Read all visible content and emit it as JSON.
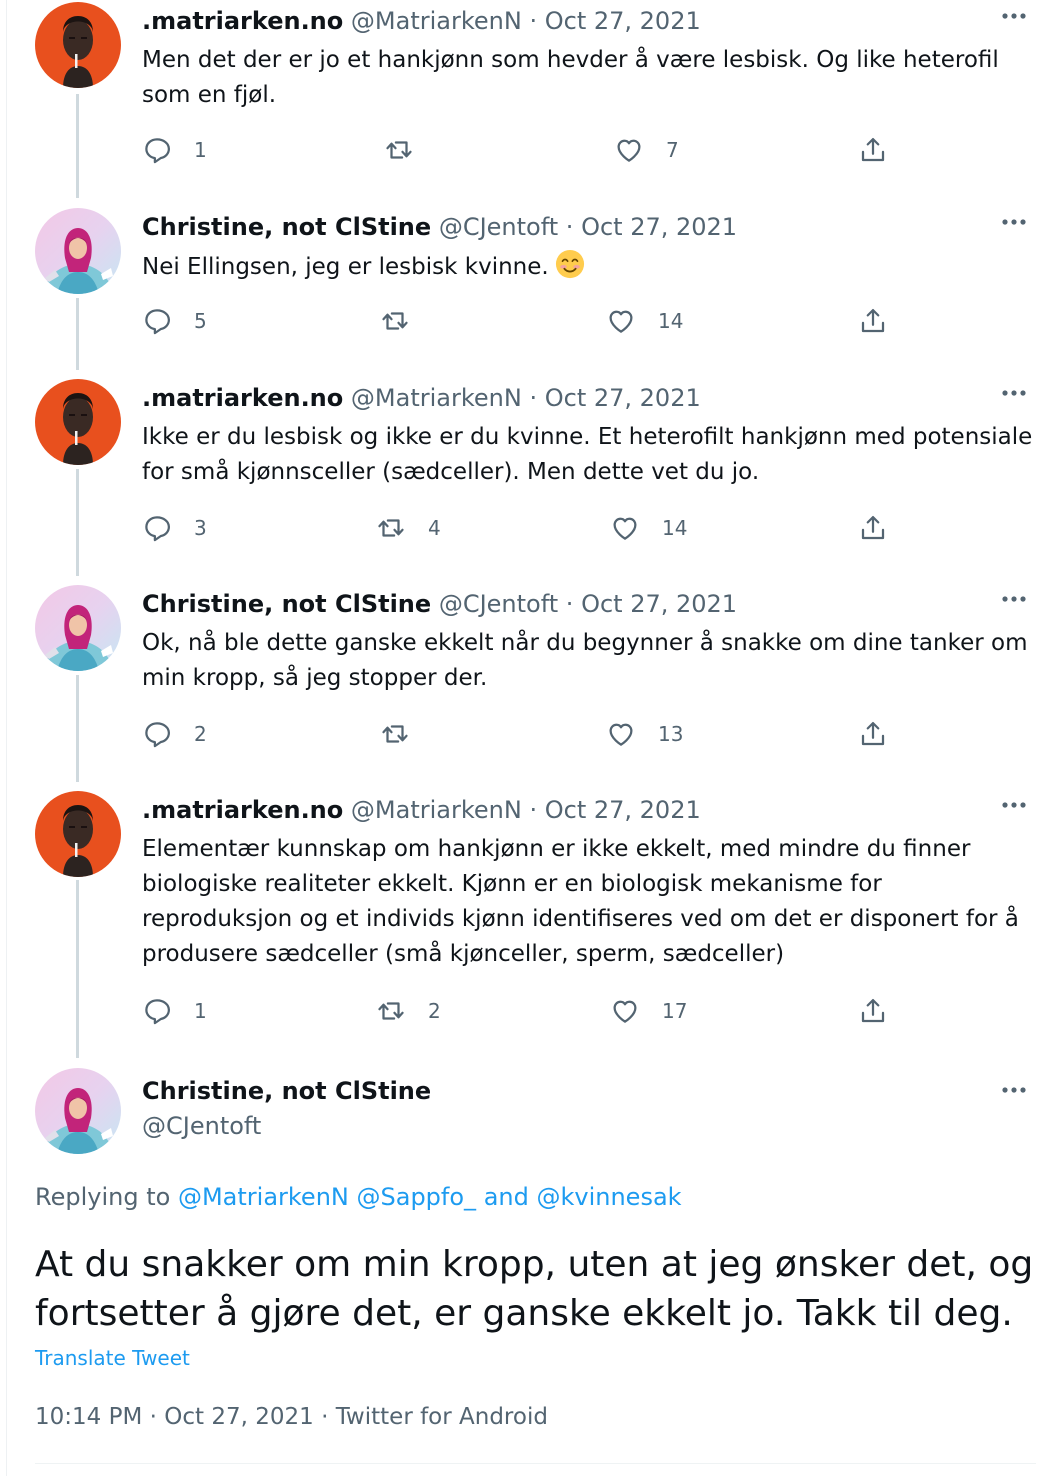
{
  "tweets": [
    {
      "name": ".matriarken.no",
      "handle": "@MatriarkenN",
      "sep": "·",
      "date": "Oct 27, 2021",
      "text": "Men det der er jo et hankjønn som hevder å være lesbisk. Og like heterofil som en fjøl.",
      "replies": "1",
      "retweets": "",
      "likes": "7"
    },
    {
      "name": "Christine, not ClStine",
      "handle": "@CJentoft",
      "sep": "·",
      "date": "Oct 27, 2021",
      "text": "Nei Ellingsen, jeg er lesbisk kvinne.",
      "replies": "5",
      "retweets": "",
      "likes": "14"
    },
    {
      "name": ".matriarken.no",
      "handle": "@MatriarkenN",
      "sep": "·",
      "date": "Oct 27, 2021",
      "text": "Ikke er du lesbisk og ikke er du kvinne. Et heterofilt  hankjønn med potensiale for små kjønnsceller (sædceller). Men dette vet du jo.",
      "replies": "3",
      "retweets": "4",
      "likes": "14"
    },
    {
      "name": "Christine, not ClStine",
      "handle": "@CJentoft",
      "sep": "·",
      "date": "Oct 27, 2021",
      "text": "Ok, nå ble dette ganske ekkelt når du begynner å snakke om dine tanker om min kropp, så jeg stopper der.",
      "replies": "2",
      "retweets": "",
      "likes": "13"
    },
    {
      "name": ".matriarken.no",
      "handle": "@MatriarkenN",
      "sep": "·",
      "date": "Oct 27, 2021",
      "text": "Elementær kunnskap om hankjønn er ikke ekkelt, med mindre du finner biologiske realiteter ekkelt. Kjønn er en biologisk mekanisme for reproduksjon og et individs kjønn identifiseres ved om det er disponert for å produsere sædceller (små kjønceller, sperm, sædceller)",
      "replies": "1",
      "retweets": "2",
      "likes": "17"
    }
  ],
  "main_tweet": {
    "name": "Christine, not ClStine",
    "handle": "@CJentoft",
    "replying_prefix": "Replying to",
    "replying_1": "@MatriarkenN",
    "replying_2": "@Sappfo_",
    "replying_and": "and",
    "replying_3": "@kvinnesak",
    "text": "At du snakker om min kropp, uten at jeg ønsker det, og fortsetter å gjøre det, er ganske ekkelt jo. Takk til deg.",
    "translate": "Translate Tweet",
    "time": "10:14 PM",
    "sep": "·",
    "date": "Oct 27, 2021",
    "source": "Twitter for Android"
  },
  "colors": {
    "accent": "#1d9bf0",
    "secondary_text": "#536471",
    "thread_line": "#cfd9de",
    "matriarken_avatar_bg": "#e8501e"
  },
  "icons": [
    "reply-icon",
    "retweet-icon",
    "like-icon",
    "share-icon",
    "more-icon",
    "smiling-emoji-icon"
  ]
}
